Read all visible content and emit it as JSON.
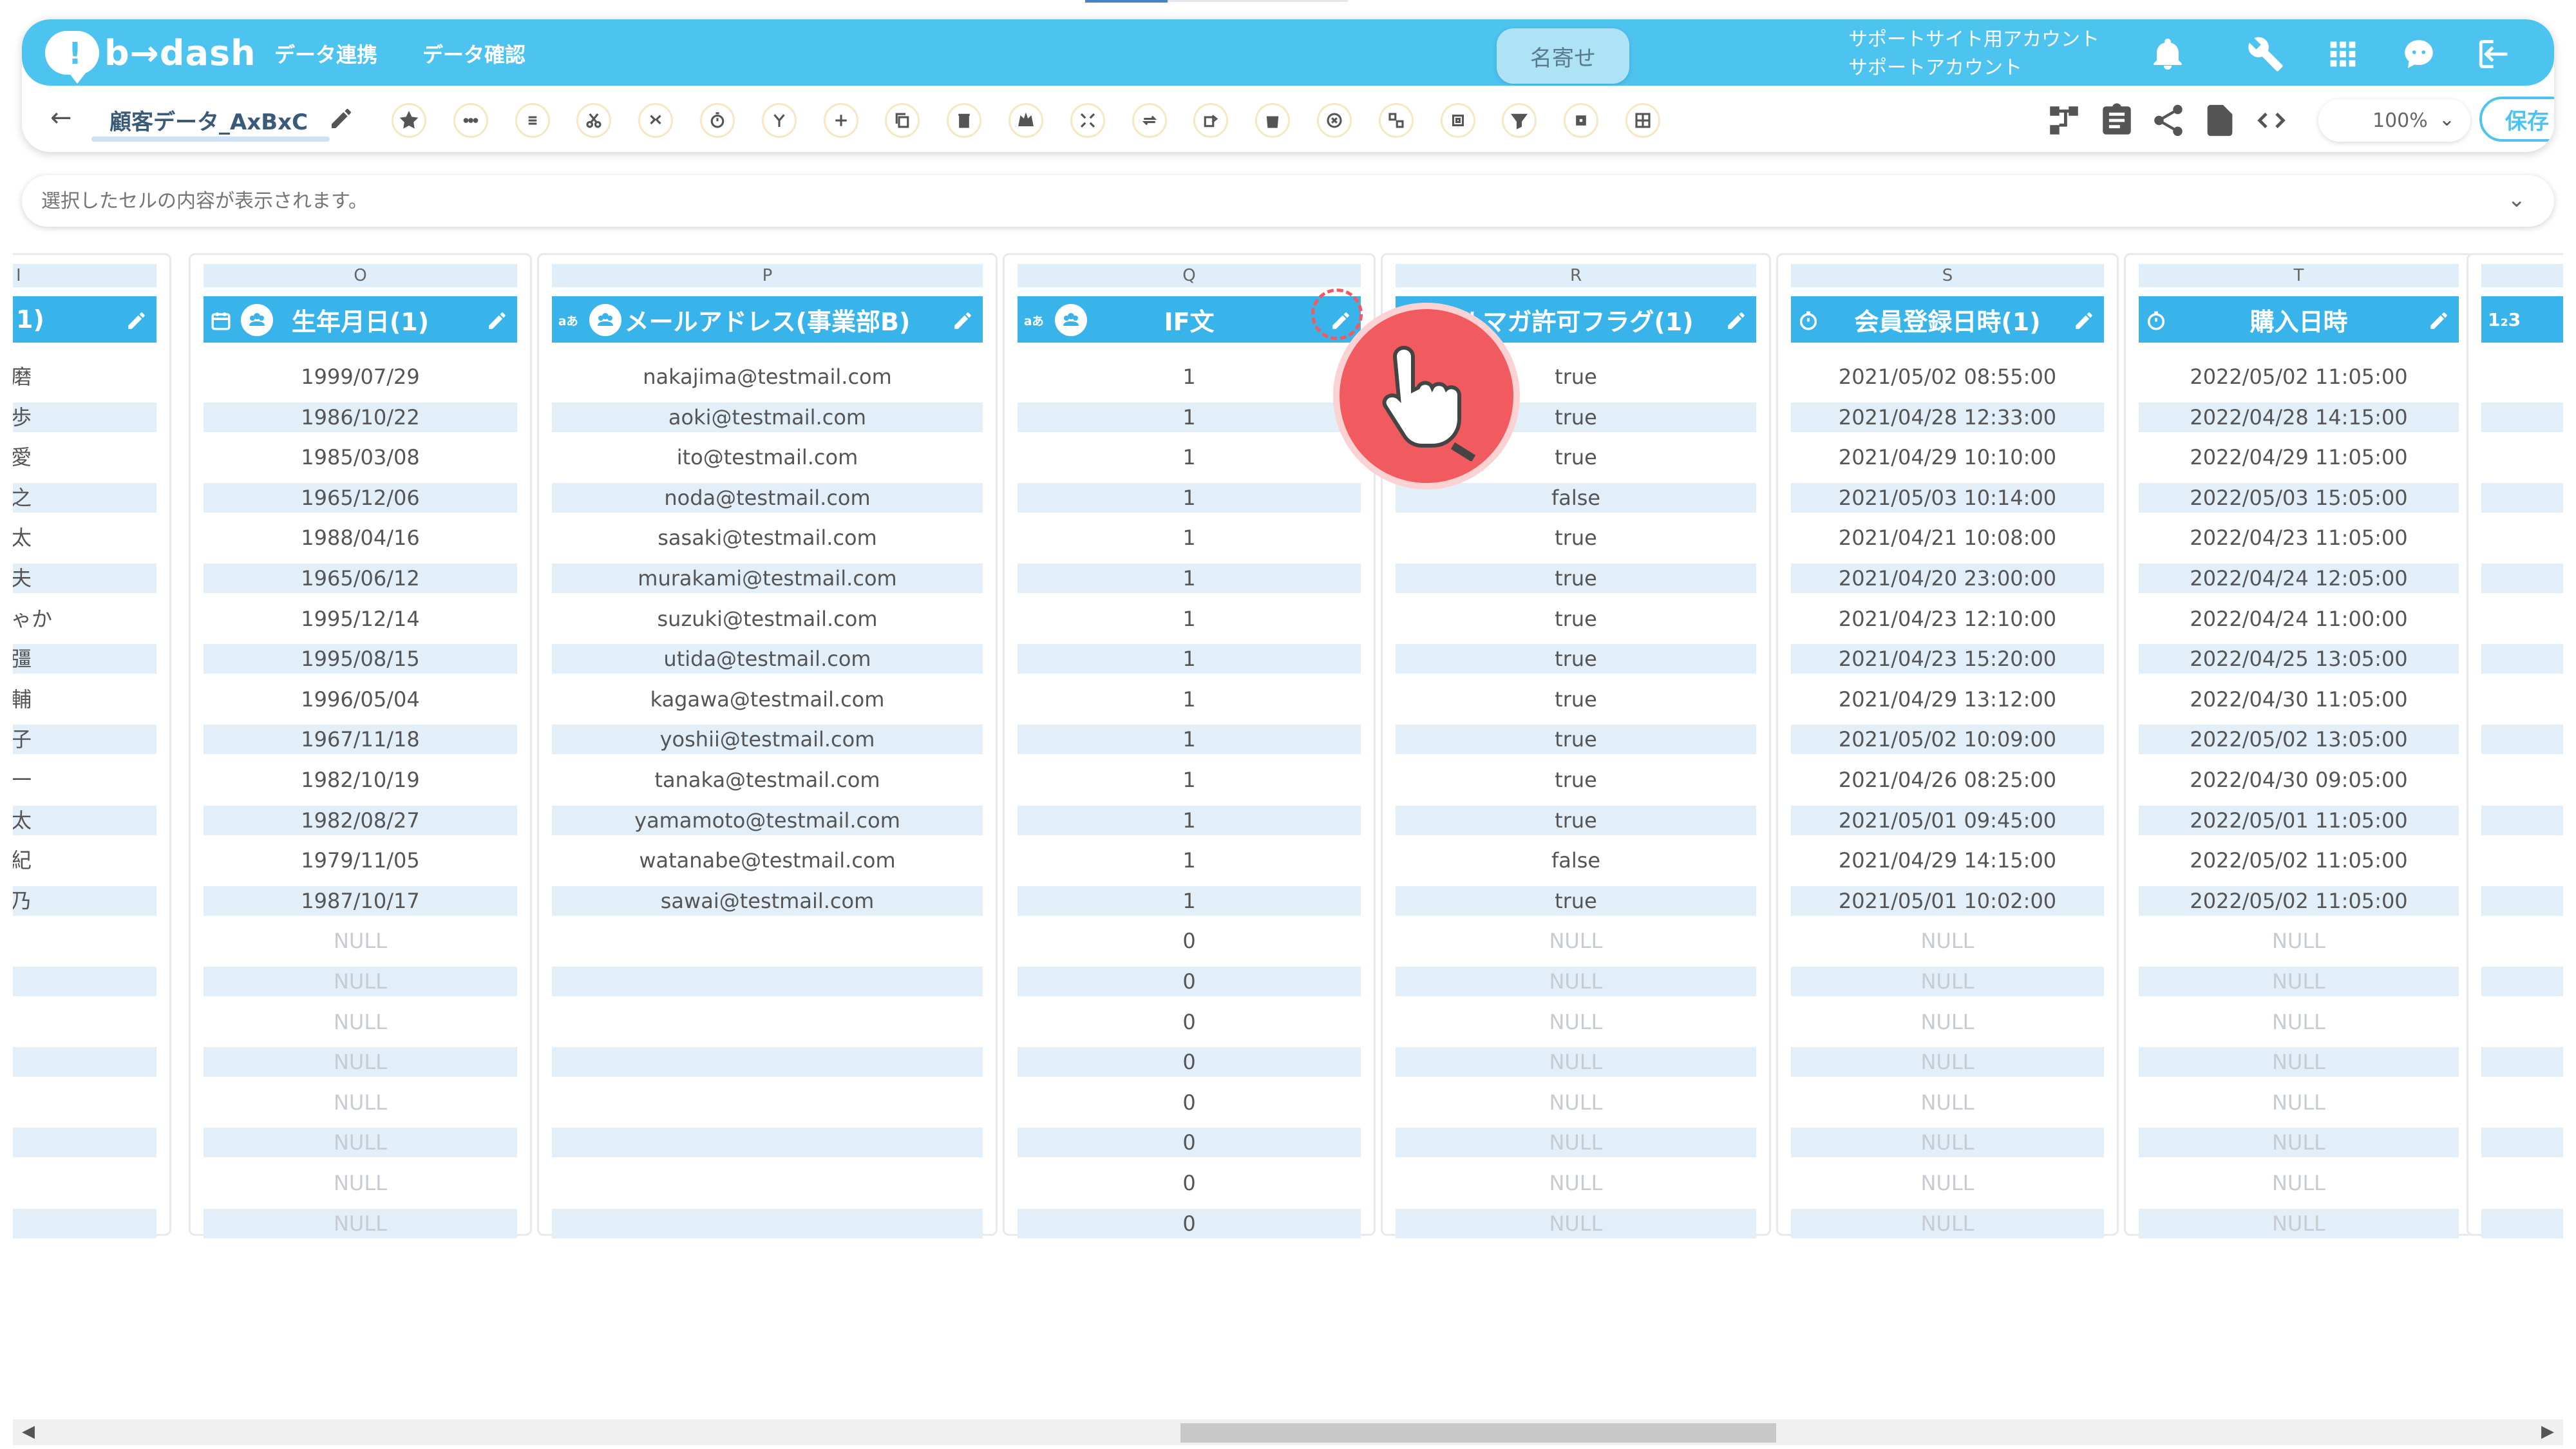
{
  "app": {
    "logo_mark": "!",
    "logo_text": "b→dash"
  },
  "nav": {
    "items": [
      "データ連携",
      "データ確認"
    ]
  },
  "name_pill": "名寄せ",
  "account": {
    "line1": "サポートサイト用アカウント",
    "line2": "サポートアカウント"
  },
  "header_icons": [
    "bell-icon",
    "wrench-icon",
    "apps-grid-icon",
    "support-chat-icon",
    "logout-icon"
  ],
  "tab": {
    "back": "←",
    "name": "顧客データ_AxBxC"
  },
  "toolbar_icons": [
    "star-icon",
    "dots-icon",
    "list-icon",
    "scissors-icon",
    "merge-icon",
    "timer-icon",
    "split-icon",
    "plus-icon",
    "copy-icon",
    "trash-icon",
    "crown-icon",
    "expand-icon",
    "loop-icon",
    "calendar-sum-icon",
    "bag-icon",
    "cancel-icon",
    "transform-icon",
    "box-icon",
    "filter-icon",
    "grid-dots-icon",
    "table-icon"
  ],
  "right_tools": [
    "flow-icon",
    "clipboard-icon",
    "share-icon",
    "refresh-doc-icon",
    "code-icon"
  ],
  "zoom": {
    "value": "100%"
  },
  "save_label": "保存",
  "cell_display": {
    "placeholder": "選択したセルの内容が表示されます。"
  },
  "partial_left": {
    "letter": "I",
    "header": "1)",
    "cells": [
      "磨",
      "歩",
      "愛",
      "之",
      "太",
      "夫",
      "ゃか",
      "彊",
      "輔",
      "子",
      "一",
      "太",
      "紀",
      "乃",
      "",
      "",
      "",
      "",
      "",
      "",
      "",
      ""
    ]
  },
  "columns": [
    {
      "letter": "O",
      "header": "生年月日(1)",
      "type": "date",
      "cells": [
        "1999/07/29",
        "1986/10/22",
        "1985/03/08",
        "1965/12/06",
        "1988/04/16",
        "1965/06/12",
        "1995/12/14",
        "1995/08/15",
        "1996/05/04",
        "1967/11/18",
        "1982/10/19",
        "1982/08/27",
        "1979/11/05",
        "1987/10/17",
        "NULL",
        "NULL",
        "NULL",
        "NULL",
        "NULL",
        "NULL",
        "NULL",
        "NULL"
      ]
    },
    {
      "letter": "P",
      "header": "メールアドレス(事業部B)",
      "type": "text",
      "cells": [
        "nakajima@testmail.com",
        "aoki@testmail.com",
        "ito@testmail.com",
        "noda@testmail.com",
        "sasaki@testmail.com",
        "murakami@testmail.com",
        "suzuki@testmail.com",
        "utida@testmail.com",
        "kagawa@testmail.com",
        "yoshii@testmail.com",
        "tanaka@testmail.com",
        "yamamoto@testmail.com",
        "watanabe@testmail.com",
        "sawai@testmail.com",
        "",
        "",
        "",
        "",
        "",
        "",
        "",
        ""
      ]
    },
    {
      "letter": "Q",
      "header": "IF文",
      "type": "text",
      "cells": [
        "1",
        "1",
        "1",
        "1",
        "1",
        "1",
        "1",
        "1",
        "1",
        "1",
        "1",
        "1",
        "1",
        "1",
        "0",
        "0",
        "0",
        "0",
        "0",
        "0",
        "0",
        "0"
      ]
    },
    {
      "letter": "R",
      "header": "ルマガ許可フラグ(1)",
      "type": "bool",
      "cells": [
        "true",
        "true",
        "true",
        "false",
        "true",
        "true",
        "true",
        "true",
        "true",
        "true",
        "true",
        "true",
        "false",
        "true",
        "NULL",
        "NULL",
        "NULL",
        "NULL",
        "NULL",
        "NULL",
        "NULL",
        "NULL"
      ]
    },
    {
      "letter": "S",
      "header": "会員登録日時(1)",
      "type": "datetime",
      "cells": [
        "2021/05/02 08:55:00",
        "2021/04/28 12:33:00",
        "2021/04/29 10:10:00",
        "2021/05/03 10:14:00",
        "2021/04/21 10:08:00",
        "2021/04/20 23:00:00",
        "2021/04/23 12:10:00",
        "2021/04/23 15:20:00",
        "2021/04/29 13:12:00",
        "2021/05/02 10:09:00",
        "2021/04/26 08:25:00",
        "2021/05/01 09:45:00",
        "2021/04/29 14:15:00",
        "2021/05/01 10:02:00",
        "NULL",
        "NULL",
        "NULL",
        "NULL",
        "NULL",
        "NULL",
        "NULL",
        "NULL"
      ]
    },
    {
      "letter": "T",
      "header": "購入日時",
      "type": "datetime",
      "cells": [
        "2022/05/02 11:05:00",
        "2022/04/28 14:15:00",
        "2022/04/29 11:05:00",
        "2022/05/03 15:05:00",
        "2022/04/23 11:05:00",
        "2022/04/24 12:05:00",
        "2022/04/24 11:00:00",
        "2022/04/25 13:05:00",
        "2022/04/30 11:05:00",
        "2022/05/02 13:05:00",
        "2022/04/30 09:05:00",
        "2022/05/01 11:05:00",
        "2022/05/02 11:05:00",
        "2022/05/02 11:05:00",
        "NULL",
        "NULL",
        "NULL",
        "NULL",
        "NULL",
        "NULL",
        "NULL",
        "NULL"
      ]
    }
  ],
  "partial_right": {
    "header": "1₂3"
  },
  "scroll": {
    "left": "◀",
    "right": "▶"
  }
}
